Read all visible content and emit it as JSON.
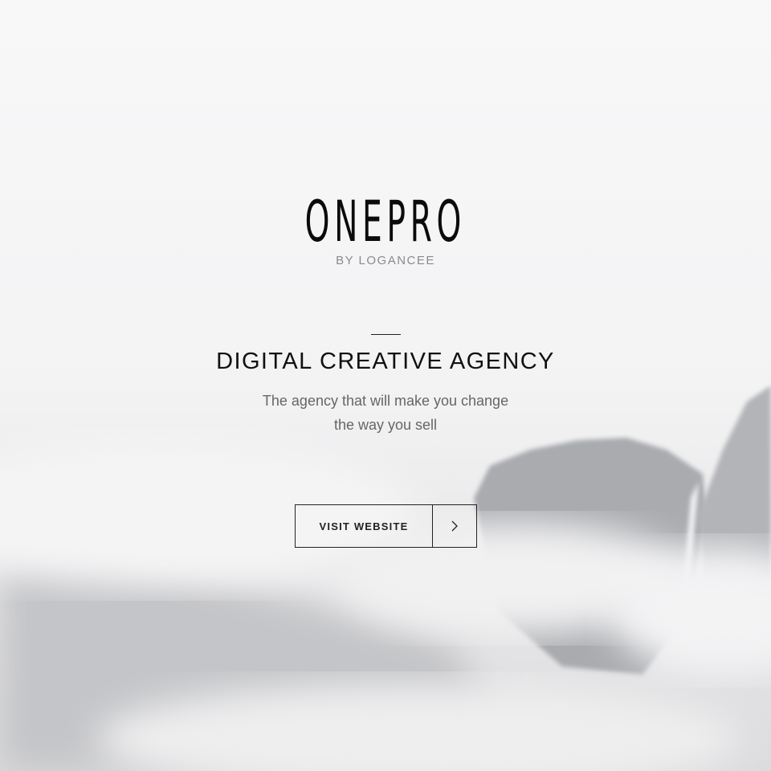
{
  "brand": {
    "name": "ONEPRO",
    "byline": "BY LOGANCEE"
  },
  "hero": {
    "headline": "DIGITAL CREATIVE AGENCY",
    "subtitle_line1": "The agency that will make you change",
    "subtitle_line2": "the way you sell"
  },
  "cta": {
    "label": "VISIT WEBSITE",
    "icon": "chevron-right-icon"
  },
  "colors": {
    "text": "#111111",
    "muted": "#8a8a8a",
    "background": "#f7f7f8"
  }
}
